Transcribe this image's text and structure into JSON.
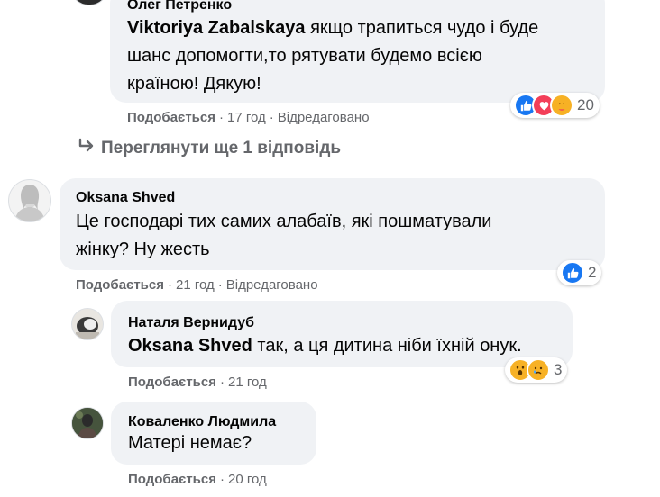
{
  "comments": [
    {
      "author": "Олег Петренко",
      "mention": "Viktoriya Zabalskaya",
      "text_line1": " якщо трапиться чудо і буде",
      "text_line2": "шанс допомогти,то рятувати будемо всією",
      "text_line3": "країною! Дякую!",
      "like_label": "Подобається",
      "time": "17 год",
      "edited": "Відредаговано",
      "reactions": [
        "like",
        "love",
        "care"
      ],
      "reaction_count": "20"
    },
    {
      "author": "Oksana Shved",
      "text_line1": "Це господарі тих самих алабаїв, які пошматували",
      "text_line2": "жінку? Ну жесть",
      "like_label": "Подобається",
      "time": "21 год",
      "edited": "Відредаговано",
      "reactions": [
        "like"
      ],
      "reaction_count": "2"
    },
    {
      "author": "Наталя Вернидуб",
      "mention": "Oksana Shved",
      "text_line1": " так, а ця дитина ніби їхній онук.",
      "like_label": "Подобається",
      "time": "21 год",
      "reactions": [
        "wow",
        "sad"
      ],
      "reaction_count": "3"
    },
    {
      "author": "Коваленко Людмила",
      "text_line1": "Матері немає?",
      "like_label": "Подобається",
      "time": "20 год"
    }
  ],
  "view_more_replies": "Переглянути ще 1 відповідь",
  "separator": "·",
  "colors": {
    "bubble": "#f0f2f5",
    "meta": "#65676b",
    "like_blue": "#1877f2",
    "love_red": "#f33e58",
    "care_yellow": "#f7b125"
  }
}
